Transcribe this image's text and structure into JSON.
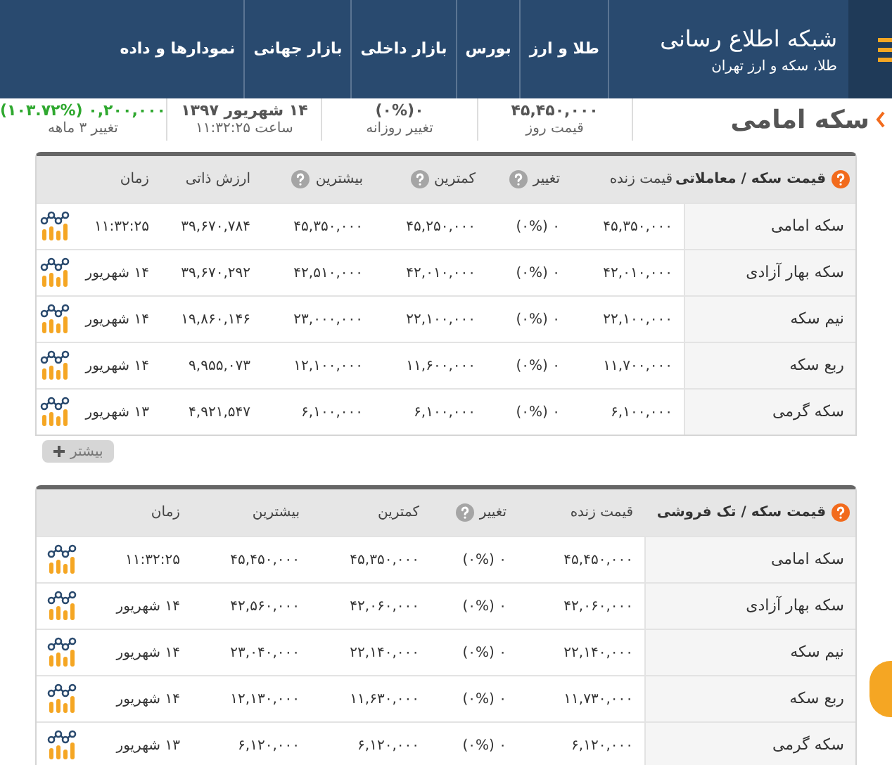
{
  "header": {
    "title": "شبکه اطلاع رسانی",
    "subtitle": "طلا، سکه و ارز تهران",
    "nav": [
      "طلا و ارز",
      "بورس",
      "بازار داخلی",
      "بازار جهانی",
      "نمودارها و داده"
    ]
  },
  "page_title": "سکه امامی",
  "stats": [
    {
      "value": "۴۵,۴۵۰,۰۰۰",
      "label": "قیمت روز",
      "kind": "neutral"
    },
    {
      "value": "۰(۰%)",
      "label": "تغییر روزانه",
      "kind": "neutral"
    },
    {
      "value": "۱۴ شهریور ۱۳۹۷",
      "label": "ساعت ۱۱:۳۲:۲۵",
      "kind": "neutral"
    },
    {
      "value": "۰,۲۰۰,۰۰۰ (۱۰۳.۷۲%)",
      "label": "تغییر ۳ ماهه",
      "kind": "positive"
    }
  ],
  "tables": [
    {
      "title": "قیمت سکه / معاملاتی",
      "columns": [
        {
          "label": "قیمت زنده",
          "help": false
        },
        {
          "label": "تغییر",
          "help": true
        },
        {
          "label": "کمترین",
          "help": true
        },
        {
          "label": "بیشترین",
          "help": true
        },
        {
          "label": "ارزش ذاتی",
          "help": false
        },
        {
          "label": "زمان",
          "help": false
        }
      ],
      "rows": [
        {
          "name": "سکه امامی",
          "cells": [
            "۴۵,۳۵۰,۰۰۰",
            "۰ (۰%)",
            "۴۵,۲۵۰,۰۰۰",
            "۴۵,۳۵۰,۰۰۰",
            "۳۹,۶۷۰,۷۸۴",
            "۱۱:۳۲:۲۵"
          ]
        },
        {
          "name": "سکه بهار آزادی",
          "cells": [
            "۴۲,۰۱۰,۰۰۰",
            "۰ (۰%)",
            "۴۲,۰۱۰,۰۰۰",
            "۴۲,۵۱۰,۰۰۰",
            "۳۹,۶۷۰,۲۹۲",
            "۱۴ شهریور"
          ]
        },
        {
          "name": "نیم سکه",
          "cells": [
            "۲۲,۱۰۰,۰۰۰",
            "۰ (۰%)",
            "۲۲,۱۰۰,۰۰۰",
            "۲۳,۰۰۰,۰۰۰",
            "۱۹,۸۶۰,۱۴۶",
            "۱۴ شهریور"
          ]
        },
        {
          "name": "ربع سکه",
          "cells": [
            "۱۱,۷۰۰,۰۰۰",
            "۰ (۰%)",
            "۱۱,۶۰۰,۰۰۰",
            "۱۲,۱۰۰,۰۰۰",
            "۹,۹۵۵,۰۷۳",
            "۱۴ شهریور"
          ]
        },
        {
          "name": "سکه گرمی",
          "cells": [
            "۶,۱۰۰,۰۰۰",
            "۰ (۰%)",
            "۶,۱۰۰,۰۰۰",
            "۶,۱۰۰,۰۰۰",
            "۴,۹۲۱,۵۴۷",
            "۱۳ شهریور"
          ]
        }
      ],
      "more_button": "بیشتر"
    },
    {
      "title": "قیمت سکه / تک فروشی",
      "columns": [
        {
          "label": "قیمت زنده",
          "help": false
        },
        {
          "label": "تغییر",
          "help": true
        },
        {
          "label": "کمترین",
          "help": false
        },
        {
          "label": "بیشترین",
          "help": false
        },
        {
          "label": "زمان",
          "help": false
        }
      ],
      "rows": [
        {
          "name": "سکه امامی",
          "cells": [
            "۴۵,۴۵۰,۰۰۰",
            "۰ (۰%)",
            "۴۵,۳۵۰,۰۰۰",
            "۴۵,۴۵۰,۰۰۰",
            "۱۱:۳۲:۲۵"
          ]
        },
        {
          "name": "سکه بهار آزادی",
          "cells": [
            "۴۲,۰۶۰,۰۰۰",
            "۰ (۰%)",
            "۴۲,۰۶۰,۰۰۰",
            "۴۲,۵۶۰,۰۰۰",
            "۱۴ شهریور"
          ]
        },
        {
          "name": "نیم سکه",
          "cells": [
            "۲۲,۱۴۰,۰۰۰",
            "۰ (۰%)",
            "۲۲,۱۴۰,۰۰۰",
            "۲۳,۰۴۰,۰۰۰",
            "۱۴ شهریور"
          ]
        },
        {
          "name": "ربع سکه",
          "cells": [
            "۱۱,۷۳۰,۰۰۰",
            "۰ (۰%)",
            "۱۱,۶۳۰,۰۰۰",
            "۱۲,۱۳۰,۰۰۰",
            "۱۴ شهریور"
          ]
        },
        {
          "name": "سکه گرمی",
          "cells": [
            "۶,۱۲۰,۰۰۰",
            "۰ (۰%)",
            "۶,۱۲۰,۰۰۰",
            "۶,۱۲۰,۰۰۰",
            "۱۳ شهریور"
          ]
        }
      ]
    }
  ]
}
